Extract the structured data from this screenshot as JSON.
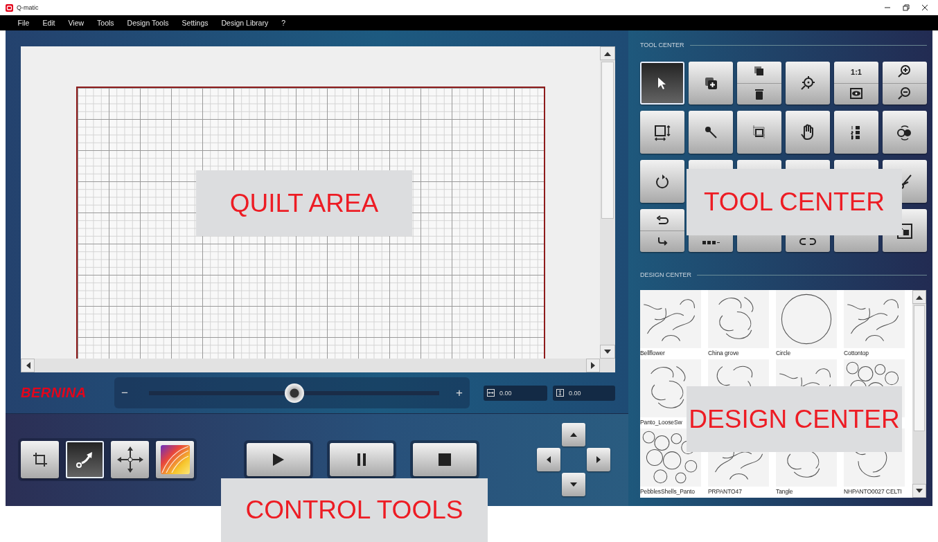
{
  "window": {
    "title": "Q-matic"
  },
  "menu": [
    "File",
    "Edit",
    "View",
    "Tools",
    "Design Tools",
    "Settings",
    "Design Library",
    "?"
  ],
  "zoom_slider": {
    "minus": "−",
    "plus": "+",
    "level": 0.5
  },
  "logo": "BERNINA",
  "width_field": {
    "value": "0.00"
  },
  "height_field": {
    "value": "0.00"
  },
  "control_tools": {
    "modes": [
      {
        "kind": "crop",
        "selected": false
      },
      {
        "kind": "path",
        "selected": true
      },
      {
        "kind": "move",
        "selected": false
      },
      {
        "kind": "color",
        "selected": false
      }
    ],
    "playback": [
      {
        "kind": "play"
      },
      {
        "kind": "pause"
      },
      {
        "kind": "stop"
      }
    ]
  },
  "tool_center": {
    "title": "TOOL CENTER",
    "tools": [
      {
        "kind": "pointer",
        "selected": true
      },
      {
        "kind": "add-copy",
        "selected": false
      },
      {
        "kind": "copy-delete",
        "selected": false
      },
      {
        "kind": "target",
        "selected": false
      },
      {
        "kind": "actual-size",
        "label": "1:1",
        "selected": false
      },
      {
        "kind": "zoom",
        "selected": false
      },
      {
        "kind": "resize",
        "selected": false
      },
      {
        "kind": "pin",
        "selected": false
      },
      {
        "kind": "crop",
        "selected": false
      },
      {
        "kind": "hand",
        "selected": false
      },
      {
        "kind": "numbered",
        "selected": false
      },
      {
        "kind": "swap",
        "selected": false
      },
      {
        "kind": "rotate",
        "selected": false
      },
      {
        "kind": "blank",
        "selected": false
      },
      {
        "kind": "blank",
        "selected": false
      },
      {
        "kind": "blank",
        "selected": false
      },
      {
        "kind": "blank",
        "selected": false
      },
      {
        "kind": "scissors",
        "selected": false
      },
      {
        "kind": "undo-redo",
        "selected": false
      },
      {
        "kind": "dots",
        "selected": false
      },
      {
        "kind": "blank",
        "selected": false
      },
      {
        "kind": "link",
        "selected": false
      },
      {
        "kind": "blank",
        "selected": false
      },
      {
        "kind": "layer",
        "selected": false
      }
    ]
  },
  "design_center": {
    "title": "DESIGN CENTER",
    "designs": [
      {
        "kind": "motif",
        "name": "Bellflower"
      },
      {
        "kind": "motif",
        "name": "China grove"
      },
      {
        "kind": "circle",
        "name": "Circle"
      },
      {
        "kind": "motif",
        "name": "Cottontop"
      },
      {
        "kind": "motif",
        "name": "Panto_LooseSw"
      },
      {
        "kind": "motif"
      },
      {
        "kind": "motif"
      },
      {
        "kind": "circles"
      },
      {
        "kind": "circles",
        "name": "PebblesShells_Panto"
      },
      {
        "kind": "motif",
        "name": "PRPANTO47"
      },
      {
        "kind": "motif",
        "name": "Tangle"
      },
      {
        "kind": "motif",
        "name": "NHPANTO0027 CELTI"
      }
    ]
  },
  "callouts": [
    {
      "kind": "quilt",
      "text": "QUILT AREA"
    },
    {
      "kind": "tool",
      "text": "TOOL CENTER"
    },
    {
      "kind": "design",
      "text": "DESIGN CENTER"
    },
    {
      "kind": "control",
      "text": "CONTROL TOOLS"
    }
  ]
}
